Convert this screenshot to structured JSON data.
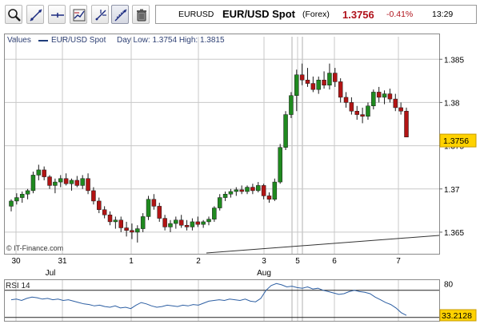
{
  "toolbar": {
    "icons": [
      "zoom-icon",
      "draw-line-icon",
      "horizontal-line-icon",
      "indicators-icon",
      "crosshair-icon",
      "trendline-tool-icon",
      "trash-icon"
    ],
    "active": "trendline-tool-icon"
  },
  "ticker": {
    "symbol": "EURUSD",
    "title": "EUR/USD Spot",
    "source": "(Forex)",
    "price": "1.3756",
    "change": "-0.41%",
    "time": "13:29",
    "price_color": "#b0121b"
  },
  "legend": {
    "values_label": "Values",
    "series_name": "EUR/USD Spot",
    "day_low_high": "Day Low: 1.3754 High: 1.3815"
  },
  "watermark": "© IT-Finance.com",
  "rsi_label": "RSI 14",
  "rsi_value": "33.2128",
  "chart_data": [
    {
      "type": "candlestick",
      "series": "EUR/USD Spot",
      "ylim": [
        1.3625,
        1.3865
      ],
      "yticks": [
        "1.385",
        "1.38",
        "1.375",
        "1.37",
        "1.365"
      ],
      "x_day_labels": [
        "30",
        "31",
        "1",
        "2",
        "3",
        "5",
        "6",
        "7"
      ],
      "x_month_labels": [
        "Jul",
        "Aug"
      ],
      "last_price_label": "1.3756",
      "candles": [
        [
          1.368,
          1.3688,
          1.3674,
          1.3686
        ],
        [
          1.3686,
          1.3695,
          1.3682,
          1.369
        ],
        [
          1.369,
          1.3697,
          1.3684,
          1.3694
        ],
        [
          1.3694,
          1.37,
          1.3688,
          1.3698
        ],
        [
          1.3698,
          1.372,
          1.3695,
          1.3716
        ],
        [
          1.3716,
          1.3728,
          1.371,
          1.3722
        ],
        [
          1.3722,
          1.3726,
          1.371,
          1.3714
        ],
        [
          1.3714,
          1.3716,
          1.37,
          1.3704
        ],
        [
          1.3704,
          1.3712,
          1.3695,
          1.3708
        ],
        [
          1.3708,
          1.3716,
          1.3702,
          1.3712
        ],
        [
          1.3712,
          1.3718,
          1.3704,
          1.3706
        ],
        [
          1.3706,
          1.3712,
          1.3698,
          1.371
        ],
        [
          1.371,
          1.3715,
          1.3702,
          1.3704
        ],
        [
          1.3704,
          1.3716,
          1.37,
          1.3712
        ],
        [
          1.3712,
          1.3718,
          1.3694,
          1.3698
        ],
        [
          1.3698,
          1.3702,
          1.3682,
          1.3686
        ],
        [
          1.3686,
          1.369,
          1.3672,
          1.3676
        ],
        [
          1.3676,
          1.368,
          1.3666,
          1.367
        ],
        [
          1.367,
          1.3674,
          1.3658,
          1.3662
        ],
        [
          1.3662,
          1.3668,
          1.3654,
          1.3664
        ],
        [
          1.3664,
          1.3668,
          1.365,
          1.3655
        ],
        [
          1.3655,
          1.3662,
          1.3645,
          1.3652
        ],
        [
          1.3652,
          1.366,
          1.3642,
          1.365
        ],
        [
          1.365,
          1.3658,
          1.3638,
          1.3654
        ],
        [
          1.3654,
          1.3672,
          1.365,
          1.3668
        ],
        [
          1.3668,
          1.3692,
          1.3664,
          1.3688
        ],
        [
          1.3688,
          1.3694,
          1.3676,
          1.368
        ],
        [
          1.368,
          1.3684,
          1.3662,
          1.3666
        ],
        [
          1.3666,
          1.367,
          1.3652,
          1.3656
        ],
        [
          1.3656,
          1.3664,
          1.365,
          1.366
        ],
        [
          1.366,
          1.3668,
          1.3654,
          1.3664
        ],
        [
          1.3664,
          1.367,
          1.3655,
          1.3658
        ],
        [
          1.3658,
          1.3664,
          1.3652,
          1.3656
        ],
        [
          1.3656,
          1.3666,
          1.3652,
          1.3662
        ],
        [
          1.3662,
          1.3668,
          1.3656,
          1.3659
        ],
        [
          1.3659,
          1.3664,
          1.3655,
          1.3662
        ],
        [
          1.3662,
          1.3668,
          1.3658,
          1.3665
        ],
        [
          1.3665,
          1.368,
          1.3662,
          1.3678
        ],
        [
          1.3678,
          1.3694,
          1.3675,
          1.369
        ],
        [
          1.369,
          1.3697,
          1.3686,
          1.3694
        ],
        [
          1.3694,
          1.37,
          1.369,
          1.3697
        ],
        [
          1.3697,
          1.3702,
          1.3692,
          1.3699
        ],
        [
          1.3699,
          1.3704,
          1.3694,
          1.3697
        ],
        [
          1.3697,
          1.3704,
          1.3694,
          1.3702
        ],
        [
          1.3702,
          1.3706,
          1.3694,
          1.3698
        ],
        [
          1.3698,
          1.3708,
          1.3696,
          1.3704
        ],
        [
          1.3704,
          1.3706,
          1.3688,
          1.3692
        ],
        [
          1.3692,
          1.3696,
          1.3684,
          1.3688
        ],
        [
          1.3688,
          1.3712,
          1.3686,
          1.3708
        ],
        [
          1.3708,
          1.3752,
          1.3706,
          1.3748
        ],
        [
          1.3748,
          1.379,
          1.3745,
          1.3786
        ],
        [
          1.3786,
          1.3812,
          1.3782,
          1.3808
        ],
        [
          1.3808,
          1.3838,
          1.379,
          1.3832
        ],
        [
          1.3832,
          1.3845,
          1.382,
          1.3826
        ],
        [
          1.3826,
          1.384,
          1.3818,
          1.3822
        ],
        [
          1.3822,
          1.383,
          1.3812,
          1.3815
        ],
        [
          1.3815,
          1.383,
          1.381,
          1.3826
        ],
        [
          1.3826,
          1.3836,
          1.3816,
          1.382
        ],
        [
          1.382,
          1.3845,
          1.3815,
          1.3834
        ],
        [
          1.3834,
          1.384,
          1.3818,
          1.3824
        ],
        [
          1.3824,
          1.3828,
          1.38,
          1.3806
        ],
        [
          1.3806,
          1.3812,
          1.3794,
          1.38
        ],
        [
          1.38,
          1.3806,
          1.3786,
          1.379
        ],
        [
          1.379,
          1.3796,
          1.378,
          1.3786
        ],
        [
          1.3786,
          1.3794,
          1.3776,
          1.3784
        ],
        [
          1.3784,
          1.38,
          1.378,
          1.3796
        ],
        [
          1.3796,
          1.3815,
          1.3792,
          1.3812
        ],
        [
          1.3812,
          1.3818,
          1.38,
          1.3806
        ],
        [
          1.3806,
          1.3814,
          1.3798,
          1.381
        ],
        [
          1.381,
          1.3816,
          1.38,
          1.3804
        ],
        [
          1.3804,
          1.381,
          1.379,
          1.3794
        ],
        [
          1.3794,
          1.38,
          1.3786,
          1.379
        ],
        [
          1.379,
          1.3794,
          1.3766,
          1.376
        ]
      ]
    },
    {
      "type": "line",
      "series": "RSI 14",
      "ylim": [
        25,
        85
      ],
      "yticks": [
        "80"
      ],
      "reference_levels": [
        70,
        30
      ],
      "values": [
        56,
        57,
        55,
        58,
        60,
        59,
        57,
        58,
        56,
        57,
        55,
        56,
        54,
        52,
        50,
        49,
        47,
        48,
        46,
        45,
        47,
        44,
        45,
        43,
        48,
        52,
        50,
        47,
        45,
        46,
        48,
        47,
        46,
        48,
        47,
        49,
        48,
        51,
        54,
        55,
        56,
        55,
        57,
        56,
        55,
        57,
        54,
        53,
        58,
        70,
        77,
        80,
        78,
        75,
        76,
        74,
        73,
        75,
        72,
        73,
        70,
        68,
        66,
        64,
        65,
        68,
        70,
        68,
        67,
        65,
        60,
        56,
        52,
        49,
        44,
        37,
        33
      ]
    }
  ]
}
